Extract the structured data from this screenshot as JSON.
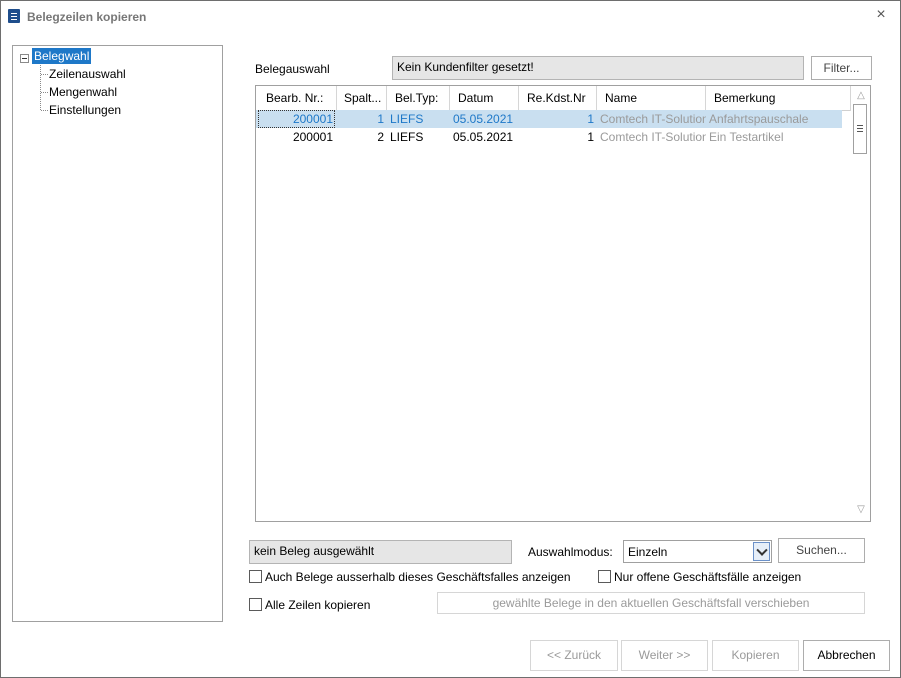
{
  "window": {
    "title": "Belegzeilen kopieren",
    "close_symbol": "×"
  },
  "tree": {
    "root": "Belegwahl",
    "items": [
      "Zeilenauswahl",
      "Mengenwahl",
      "Einstellungen"
    ]
  },
  "belegauswahl": {
    "label": "Belegauswahl",
    "filter_text": "Kein Kundenfilter gesetzt!",
    "filter_button": "Filter..."
  },
  "grid": {
    "columns": [
      "Bearb. Nr.:",
      "Spalt...",
      "Bel.Typ:",
      "Datum",
      "Re.Kdst.Nr",
      "Name",
      "Bemerkung"
    ],
    "rows": [
      {
        "bearb": "200001",
        "spalt": "1",
        "typ": "LIEFS",
        "datum": "05.05.2021",
        "kdst": "1",
        "name": "Comtech IT-Solutions",
        "bemerkung": "Anfahrtspauschale",
        "selected": true
      },
      {
        "bearb": "200001",
        "spalt": "2",
        "typ": "LIEFS",
        "datum": "05.05.2021",
        "kdst": "1",
        "name": "Comtech IT-Solutions",
        "bemerkung": "Ein Testartikel",
        "selected": false
      }
    ]
  },
  "status": {
    "selection_text": "kein Beleg ausgewählt",
    "mode_label": "Auswahlmodus:",
    "mode_value": "Einzeln",
    "search_button": "Suchen..."
  },
  "options": {
    "outside_case": "Auch Belege ausserhalb dieses Geschäftsfalles anzeigen",
    "only_open": "Nur offene Geschäftsfälle anzeigen",
    "copy_all_lines": "Alle Zeilen kopieren",
    "move_button": "gewählte Belege in den aktuellen Geschäftsfall verschieben"
  },
  "footer": {
    "back": "<< Zurück",
    "next": "Weiter >>",
    "copy": "Kopieren",
    "cancel": "Abbrechen"
  },
  "colors": {
    "accent": "#1e78c8",
    "selection_row": "#c9dff0",
    "disabled_text": "#9a9a9a"
  }
}
